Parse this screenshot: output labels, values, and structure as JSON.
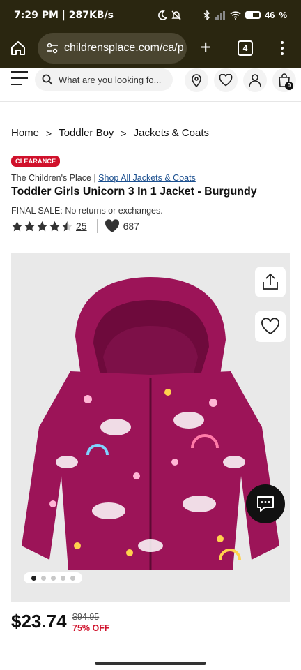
{
  "status_bar": {
    "time": "7:29 PM | 287KB/s",
    "battery": "46",
    "icons": [
      "moon-icon",
      "mute-icon",
      "bluetooth-icon",
      "signal-icon",
      "wifi-icon",
      "battery-icon"
    ]
  },
  "browser": {
    "url": "childrensplace.com/ca/p",
    "tab_count": "4"
  },
  "site_header": {
    "search_placeholder": "What are you looking fo...",
    "bag_count": "0"
  },
  "breadcrumb": {
    "items": [
      "Home",
      "Toddler Boy",
      "Jackets & Coats"
    ],
    "separator": ">"
  },
  "product": {
    "badge": "CLEARANCE",
    "brand": "The Children's Place",
    "brand_separator": "|",
    "shop_all_link": "Shop All Jackets & Coats",
    "title": "Toddler Girls Unicorn 3 In 1 Jacket - Burgundy",
    "final_sale": "FINAL SALE: No returns or exchanges.",
    "rating": 4.5,
    "review_count": "25",
    "favorites_count": "687",
    "image_count": 5,
    "active_image": 1,
    "price": "$23.74",
    "original_price": "$94.95",
    "discount": "75% OFF"
  },
  "colors": {
    "browser_chrome": "#2a2610",
    "clearance_red": "#d0112b",
    "link_blue": "#1b4f8f",
    "jacket_burgundy": "#9c1458"
  }
}
